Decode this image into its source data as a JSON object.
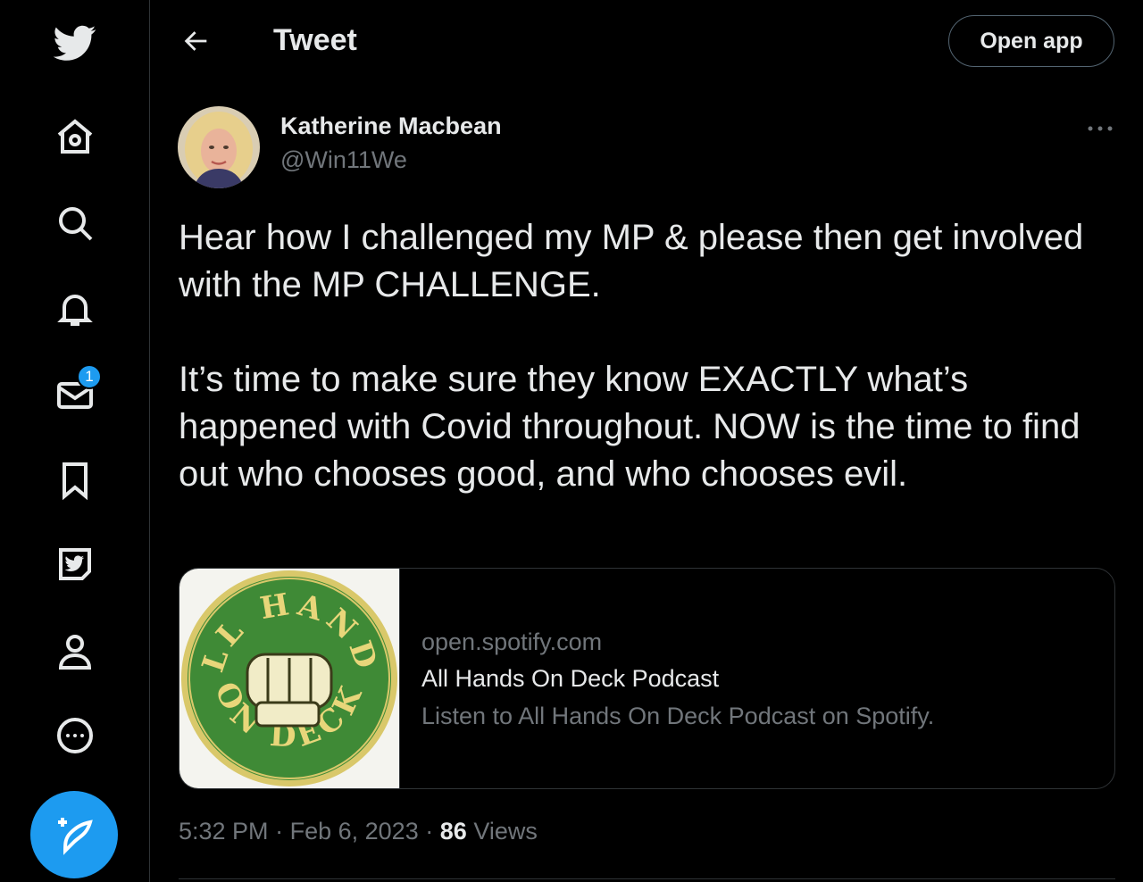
{
  "header": {
    "title": "Tweet",
    "open_app_label": "Open app"
  },
  "sidebar": {
    "icons": [
      "twitter-logo-icon",
      "home-icon",
      "search-icon",
      "bell-icon",
      "mail-icon",
      "bookmark-icon",
      "twitter-blue-icon",
      "profile-icon",
      "more-circle-icon"
    ],
    "messages_badge": "1",
    "compose_icon": "feather-plus-icon",
    "accent_color": "#1d9bf0"
  },
  "tweet": {
    "author_name": "Katherine Macbean",
    "author_handle": "@Win11We",
    "text": "Hear how I challenged my MP & please then get involved with the MP CHALLENGE.\n\nIt’s time to make sure they know EXACTLY what’s happened with Covid throughout. NOW is the time to find out who chooses good, and who chooses evil.",
    "card": {
      "image_text_top": "ALL HANDS",
      "image_text_bottom": "ON DECK",
      "domain": "open.spotify.com",
      "title": "All Hands On Deck Podcast",
      "description": "Listen to All Hands On Deck Podcast on Spotify."
    },
    "time": "5:32 PM",
    "sep1": "·",
    "date": "Feb 6, 2023",
    "sep2": "·",
    "views_count": "86",
    "views_label": "Views"
  }
}
